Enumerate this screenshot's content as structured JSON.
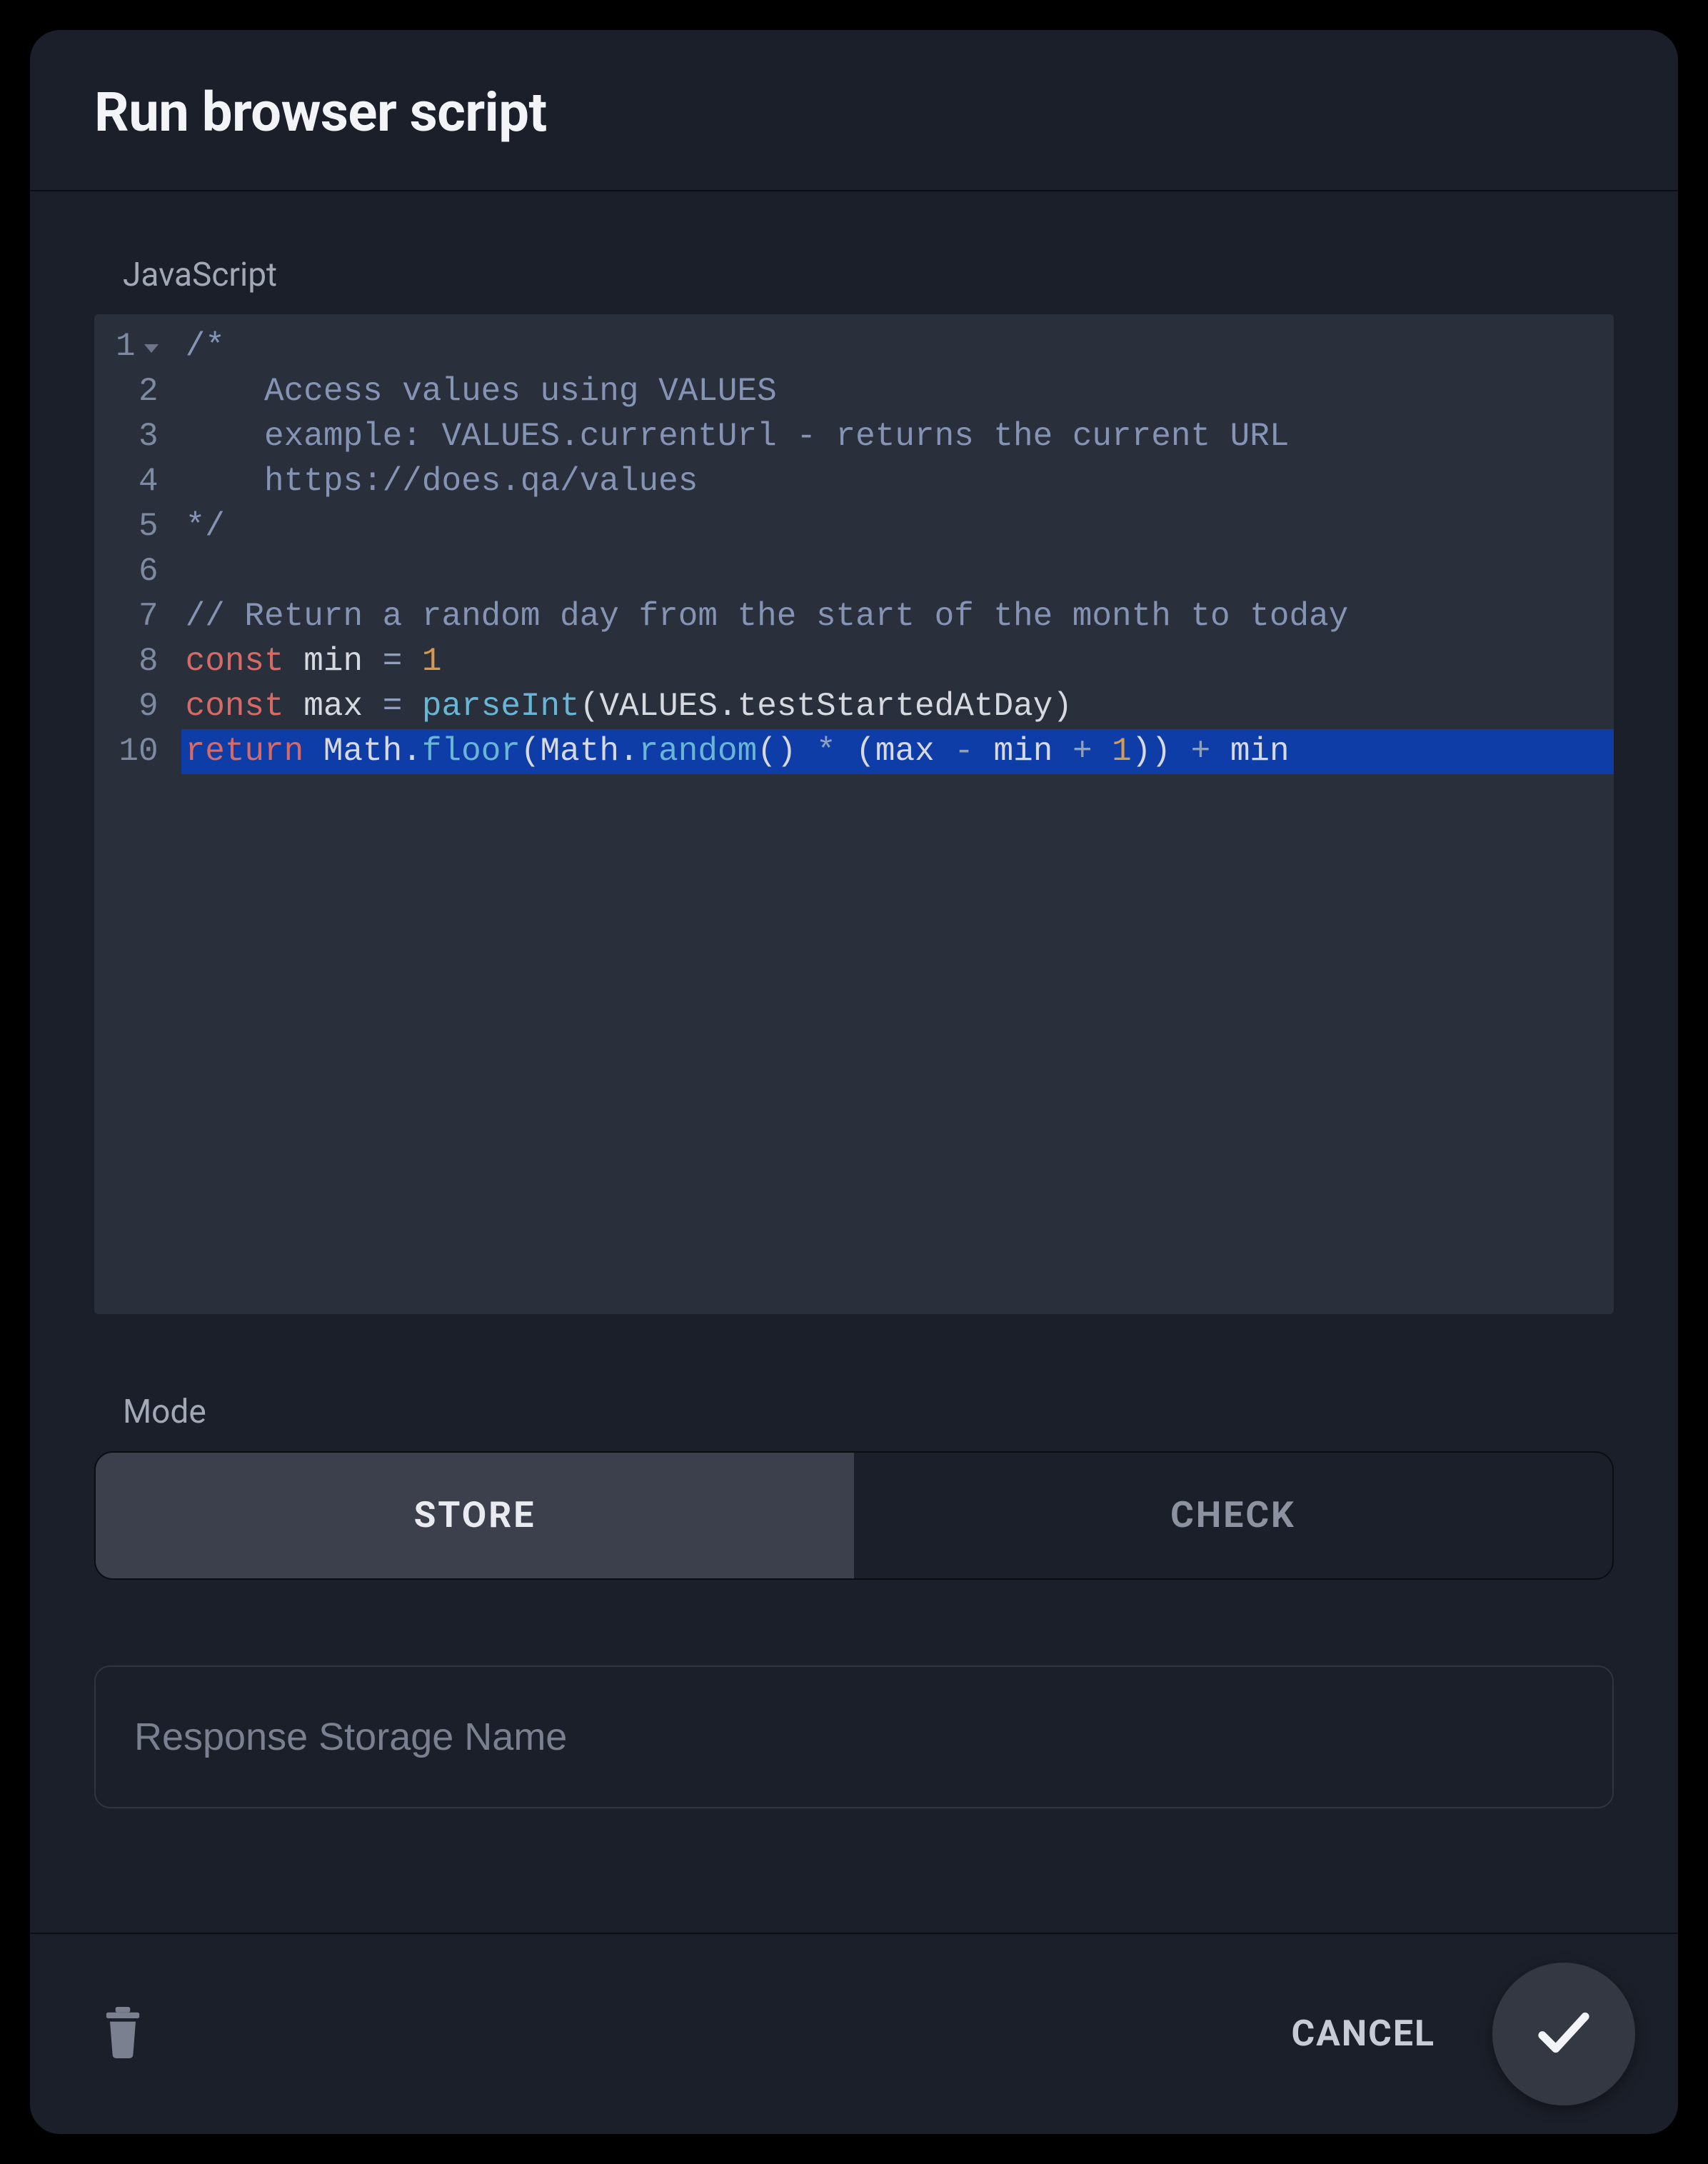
{
  "header": {
    "title": "Run browser script"
  },
  "editor": {
    "language_label": "JavaScript",
    "gutter": [
      "1",
      "2",
      "3",
      "4",
      "5",
      "6",
      "7",
      "8",
      "9",
      "10"
    ],
    "lines": [
      {
        "indent": 0,
        "selected": false,
        "fold": true,
        "tokens": [
          {
            "t": "comment",
            "v": "/*"
          }
        ]
      },
      {
        "indent": 1,
        "selected": false,
        "tokens": [
          {
            "t": "comment",
            "v": "Access values using VALUES"
          }
        ]
      },
      {
        "indent": 1,
        "selected": false,
        "tokens": [
          {
            "t": "comment",
            "v": "example: VALUES.currentUrl - returns the current URL"
          }
        ]
      },
      {
        "indent": 1,
        "selected": false,
        "tokens": [
          {
            "t": "comment",
            "v": "https://does.qa/values"
          }
        ]
      },
      {
        "indent": 0,
        "selected": false,
        "tokens": [
          {
            "t": "comment",
            "v": "*/"
          }
        ]
      },
      {
        "indent": 0,
        "selected": false,
        "tokens": []
      },
      {
        "indent": 0,
        "selected": false,
        "tokens": [
          {
            "t": "comment",
            "v": "// Return a random day from the start of the month to today"
          }
        ]
      },
      {
        "indent": 0,
        "selected": false,
        "tokens": [
          {
            "t": "kw",
            "v": "const"
          },
          {
            "t": "sp",
            "v": " "
          },
          {
            "t": "id",
            "v": "min"
          },
          {
            "t": "sp",
            "v": " "
          },
          {
            "t": "op",
            "v": "="
          },
          {
            "t": "sp",
            "v": " "
          },
          {
            "t": "num",
            "v": "1"
          }
        ]
      },
      {
        "indent": 0,
        "selected": false,
        "tokens": [
          {
            "t": "kw",
            "v": "const"
          },
          {
            "t": "sp",
            "v": " "
          },
          {
            "t": "id",
            "v": "max"
          },
          {
            "t": "sp",
            "v": " "
          },
          {
            "t": "op",
            "v": "="
          },
          {
            "t": "sp",
            "v": " "
          },
          {
            "t": "fn",
            "v": "parseInt"
          },
          {
            "t": "pn",
            "v": "("
          },
          {
            "t": "id",
            "v": "VALUES"
          },
          {
            "t": "pn",
            "v": "."
          },
          {
            "t": "id",
            "v": "testStartedAtDay"
          },
          {
            "t": "pn",
            "v": ")"
          }
        ]
      },
      {
        "indent": 0,
        "selected": true,
        "tokens": [
          {
            "t": "kw",
            "v": "return"
          },
          {
            "t": "sp",
            "v": " "
          },
          {
            "t": "id",
            "v": "Math"
          },
          {
            "t": "pn",
            "v": "."
          },
          {
            "t": "fn",
            "v": "floor"
          },
          {
            "t": "pn",
            "v": "("
          },
          {
            "t": "id",
            "v": "Math"
          },
          {
            "t": "pn",
            "v": "."
          },
          {
            "t": "fn",
            "v": "random"
          },
          {
            "t": "pn",
            "v": "()"
          },
          {
            "t": "sp",
            "v": " "
          },
          {
            "t": "op",
            "v": "*"
          },
          {
            "t": "sp",
            "v": " "
          },
          {
            "t": "pn",
            "v": "("
          },
          {
            "t": "id",
            "v": "max"
          },
          {
            "t": "sp",
            "v": " "
          },
          {
            "t": "op",
            "v": "-"
          },
          {
            "t": "sp",
            "v": " "
          },
          {
            "t": "id",
            "v": "min"
          },
          {
            "t": "sp",
            "v": " "
          },
          {
            "t": "op",
            "v": "+"
          },
          {
            "t": "sp",
            "v": " "
          },
          {
            "t": "num",
            "v": "1"
          },
          {
            "t": "pn",
            "v": "))"
          },
          {
            "t": "sp",
            "v": " "
          },
          {
            "t": "op",
            "v": "+"
          },
          {
            "t": "sp",
            "v": " "
          },
          {
            "t": "id",
            "v": "min"
          }
        ]
      }
    ]
  },
  "mode": {
    "label": "Mode",
    "options": [
      {
        "key": "store",
        "label": "STORE",
        "active": true
      },
      {
        "key": "check",
        "label": "CHECK",
        "active": false
      }
    ]
  },
  "storage": {
    "placeholder": "Response Storage Name",
    "value": ""
  },
  "footer": {
    "cancel_label": "CANCEL"
  }
}
